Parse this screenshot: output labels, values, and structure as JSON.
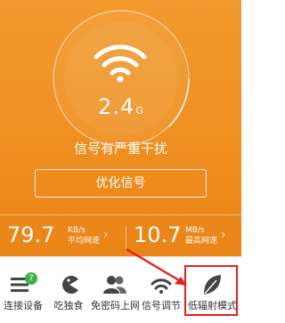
{
  "signal": {
    "band": "2.4",
    "band_unit": "G",
    "status": "信号有严重干扰",
    "optimize_label": "优化信号"
  },
  "speeds": {
    "avg": {
      "value": "79.7",
      "unit": "KB/s",
      "label": "平均网速"
    },
    "max": {
      "value": "10.7",
      "unit": "MB/s",
      "label": "最高网速"
    }
  },
  "tabs": [
    {
      "label": "连接设备",
      "icon": "list-icon",
      "badge": "7"
    },
    {
      "label": "吃独食",
      "icon": "pacman-icon"
    },
    {
      "label": "免密码上网",
      "icon": "users-icon"
    },
    {
      "label": "信号调节",
      "icon": "signal-wave-icon"
    },
    {
      "label": "低辐射模式",
      "icon": "leaf-icon"
    }
  ],
  "colors": {
    "accent": "#ef8f22",
    "highlight": "#e32121",
    "badge": "#3bb34a"
  }
}
